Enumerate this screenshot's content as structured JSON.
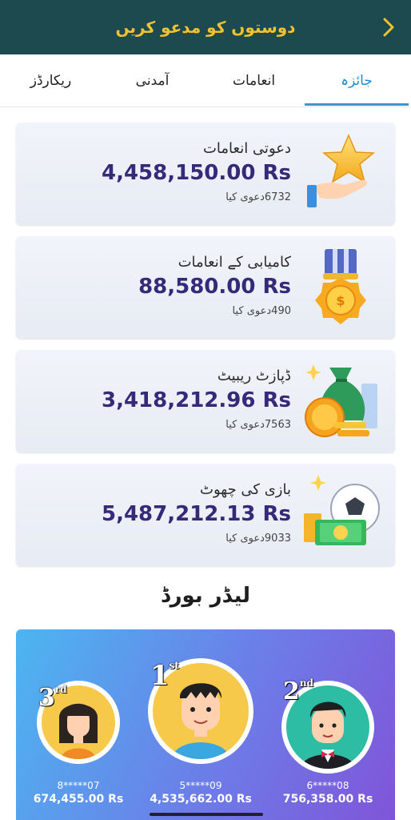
{
  "header": {
    "title": "دوستوں کو مدعو کریں"
  },
  "tabs": [
    {
      "label": "جائزہ",
      "active": true
    },
    {
      "label": "انعامات",
      "active": false
    },
    {
      "label": "آمدنی",
      "active": false
    },
    {
      "label": "ریکارڈز",
      "active": false
    }
  ],
  "cards": [
    {
      "title": "دعوتی انعامات",
      "amount": "4,458,150.00 Rs",
      "claims": "6732دعوی کیا",
      "icon": "star-hand-icon"
    },
    {
      "title": "کامیابی کے انعامات",
      "amount": "88,580.00 Rs",
      "claims": "490دعوی کیا",
      "icon": "medal-icon"
    },
    {
      "title": "ڈپازٹ ریبیٹ",
      "amount": "3,418,212.96 Rs",
      "claims": "7563دعوی کیا",
      "icon": "money-bag-icon"
    },
    {
      "title": "بازی کی چھوٹ",
      "amount": "5,487,212.13 Rs",
      "claims": "9033دعوی کیا",
      "icon": "soccer-cash-icon"
    }
  ],
  "leaderboard": {
    "title": "لیڈر بورڈ",
    "entries": [
      {
        "rank": "1",
        "suffix": "st",
        "user": "5*****09",
        "prize": "4,535,662.00 Rs"
      },
      {
        "rank": "2",
        "suffix": "nd",
        "user": "6*****08",
        "prize": "756,358.00 Rs"
      },
      {
        "rank": "3",
        "suffix": "rd",
        "user": "8*****07",
        "prize": "674,455.00 Rs"
      }
    ]
  },
  "colors": {
    "header_bg": "#1c4a4e",
    "header_text": "#f2c230",
    "active_tab": "#1a8ed0",
    "amount": "#352a7a"
  }
}
